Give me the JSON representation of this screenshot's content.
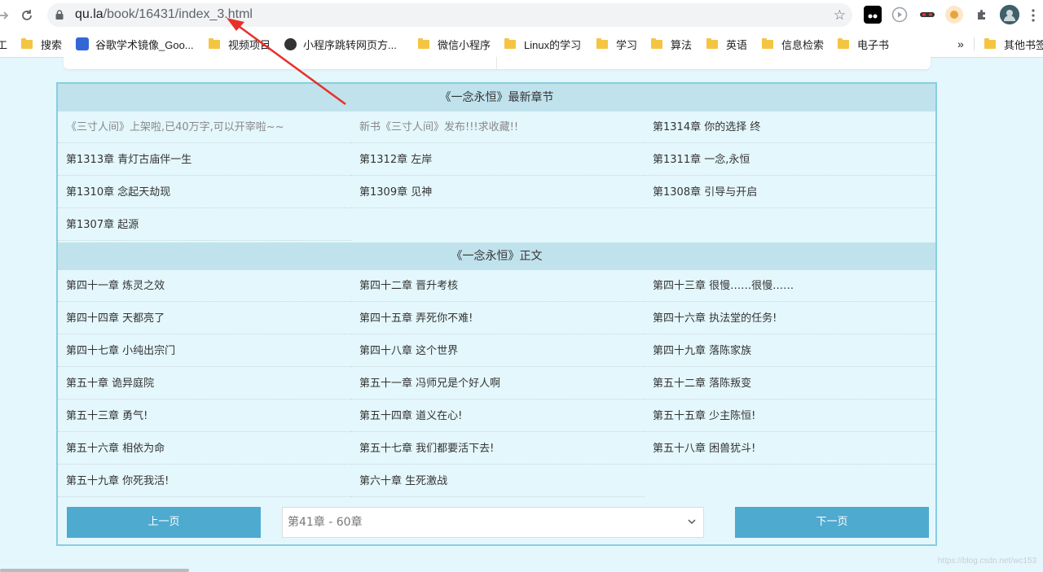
{
  "browser": {
    "url_host": "qu.la",
    "url_path": "/book/16431/index_3.html",
    "bookmarks": [
      {
        "label": "工",
        "kind": "partial"
      },
      {
        "label": "搜索",
        "kind": "folder"
      },
      {
        "label": "谷歌学术镜像_Goo...",
        "kind": "site"
      },
      {
        "label": "视频项目",
        "kind": "folder"
      },
      {
        "label": "小程序跳转网页方...",
        "kind": "site"
      },
      {
        "label": "微信小程序",
        "kind": "folder"
      },
      {
        "label": "Linux的学习",
        "kind": "folder"
      },
      {
        "label": "学习",
        "kind": "folder"
      },
      {
        "label": "算法",
        "kind": "folder"
      },
      {
        "label": "英语",
        "kind": "folder"
      },
      {
        "label": "信息检索",
        "kind": "folder"
      },
      {
        "label": "电子书",
        "kind": "folder"
      },
      {
        "label": "其他书签",
        "kind": "folder"
      }
    ],
    "overflow": "»"
  },
  "latest": {
    "title": "《一念永恒》最新章节",
    "items": [
      "《三寸人间》上架啦,已40万字,可以开宰啦~~",
      "新书《三寸人间》发布!!!求收藏!!",
      "第1314章 你的选择 终",
      "第1313章 青灯古庙伴一生",
      "第1312章 左岸",
      "第1311章 一念,永恒",
      "第1310章 念起天劫现",
      "第1309章 见神",
      "第1308章 引导与开启",
      "第1307章 起源"
    ]
  },
  "main": {
    "title": "《一念永恒》正文",
    "items": [
      "第四十一章 炼灵之效",
      "第四十二章 晋升考核",
      "第四十三章 很慢……很慢……",
      "第四十四章 天都亮了",
      "第四十五章 弄死你不难!",
      "第四十六章 执法堂的任务!",
      "第四十七章 小纯出宗门",
      "第四十八章 这个世界",
      "第四十九章 落陈家族",
      "第五十章 诡异庭院",
      "第五十一章 冯师兄是个好人啊",
      "第五十二章 落陈叛变",
      "第五十三章 勇气!",
      "第五十四章 道义在心!",
      "第五十五章 少主陈恒!",
      "第五十六章 相依为命",
      "第五十七章 我们都要活下去!",
      "第五十八章 困兽犹斗!",
      "第五十九章 你死我活!",
      "第六十章 生死激战"
    ]
  },
  "pager": {
    "prev": "上一页",
    "next": "下一页",
    "selected": "第41章 - 60章"
  },
  "watermark": "https://blog.csdn.net/wc153",
  "colors": {
    "page_bg": "#e4f7fc",
    "section_head": "#c0e2ec",
    "button": "#4eaacf",
    "arrow": "#e8302a"
  }
}
